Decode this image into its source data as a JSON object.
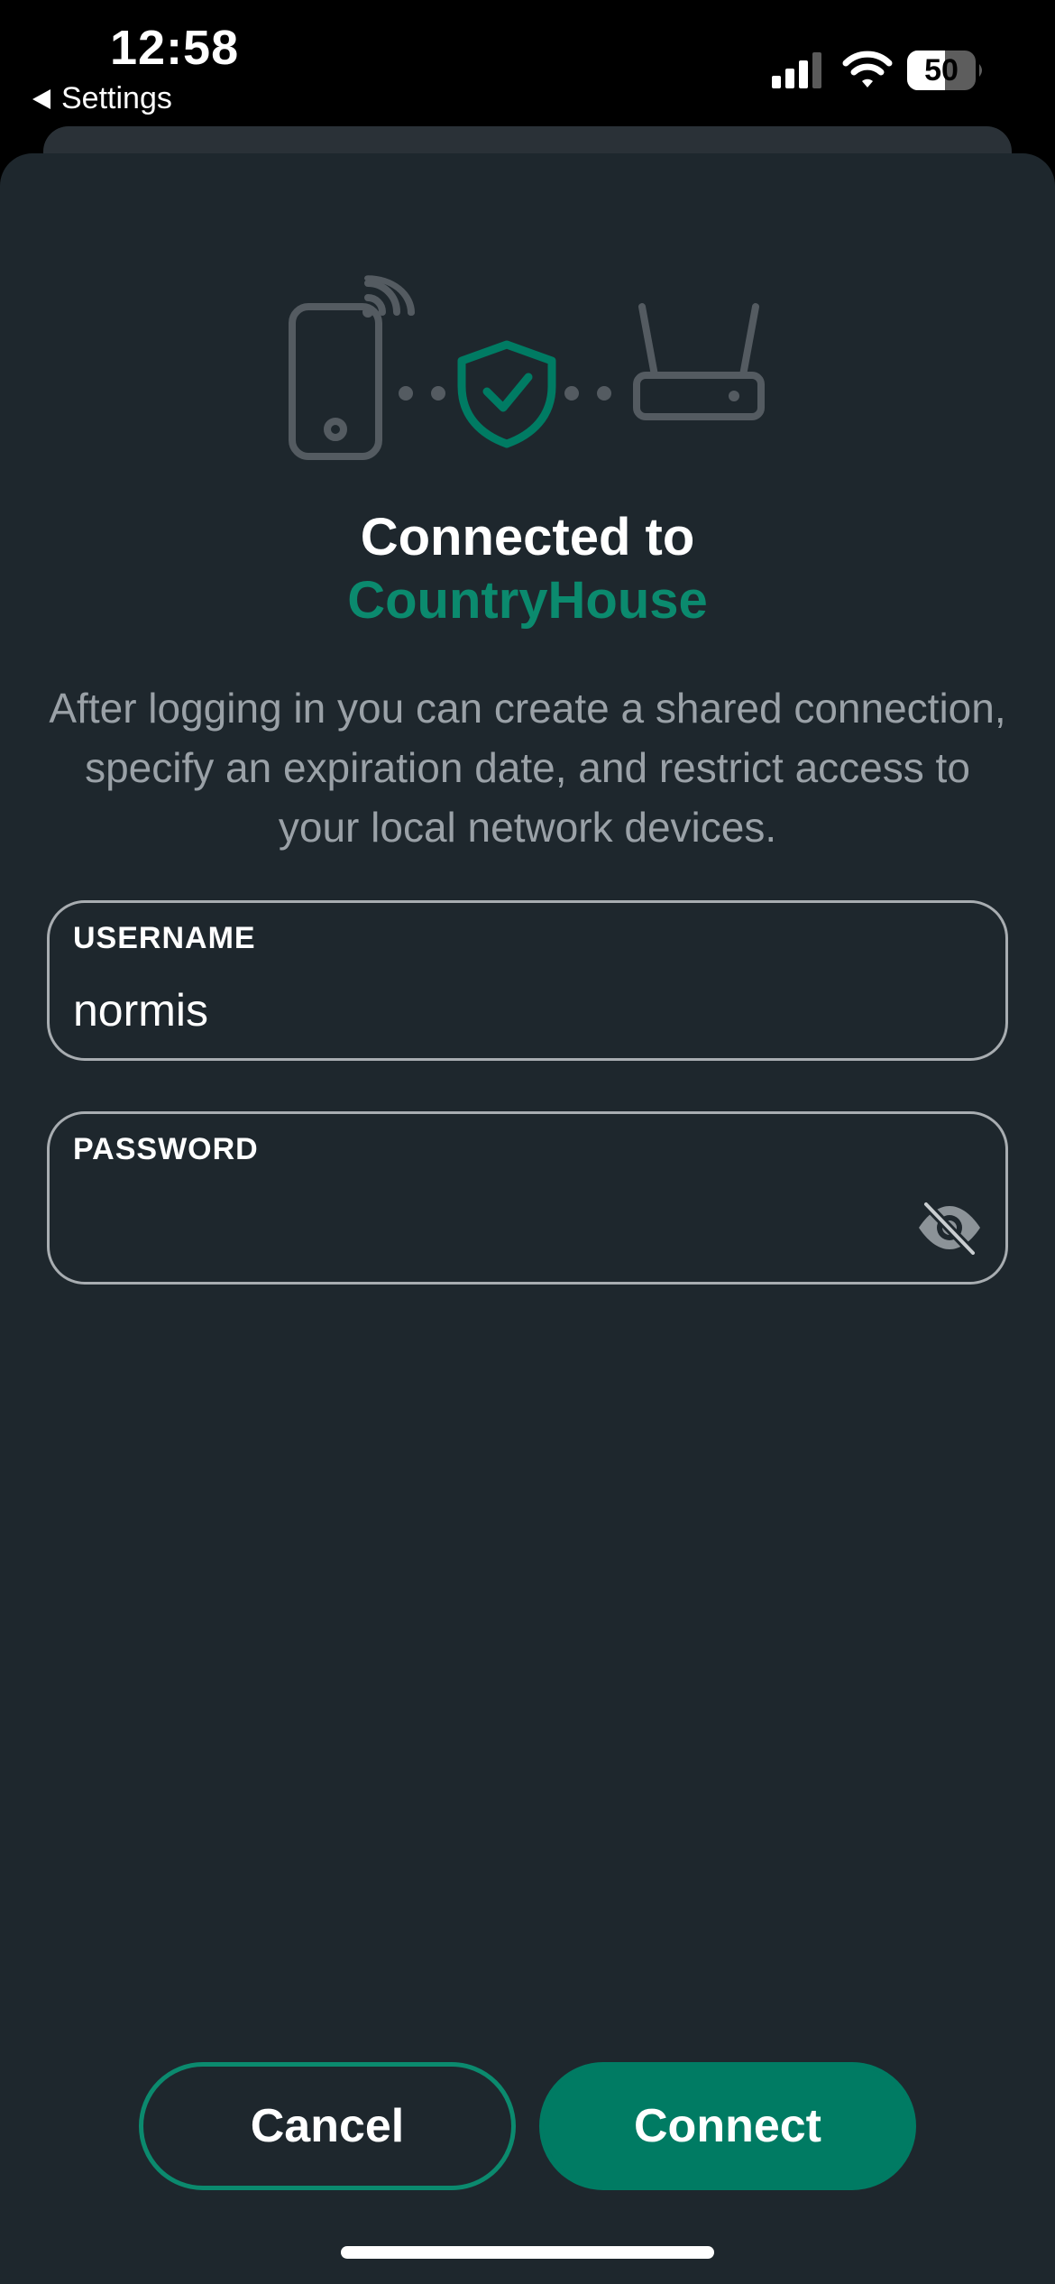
{
  "status_bar": {
    "time": "12:58",
    "back_label": "Settings",
    "battery_level": "50",
    "icons": [
      "signal-icon",
      "wifi-icon",
      "battery-icon"
    ]
  },
  "hero": {
    "icons": [
      "phone-icon",
      "shield-check-icon",
      "router-icon"
    ]
  },
  "title": "Connected to",
  "network_name": "CountryHouse",
  "description": "After logging in you can create a shared connection, specify an expiration date, and restrict access to your local network devices.",
  "form": {
    "username": {
      "label": "USERNAME",
      "value": "normis"
    },
    "password": {
      "label": "PASSWORD",
      "value": "",
      "toggle_icon": "eye-slash-icon"
    }
  },
  "buttons": {
    "cancel": "Cancel",
    "connect": "Connect"
  },
  "colors": {
    "accent": "#0b8a6e",
    "button_fill": "#007b63",
    "sheet_background": "#1e272d",
    "illustration_gray": "#545b61",
    "muted_text": "#9aa1a7"
  }
}
